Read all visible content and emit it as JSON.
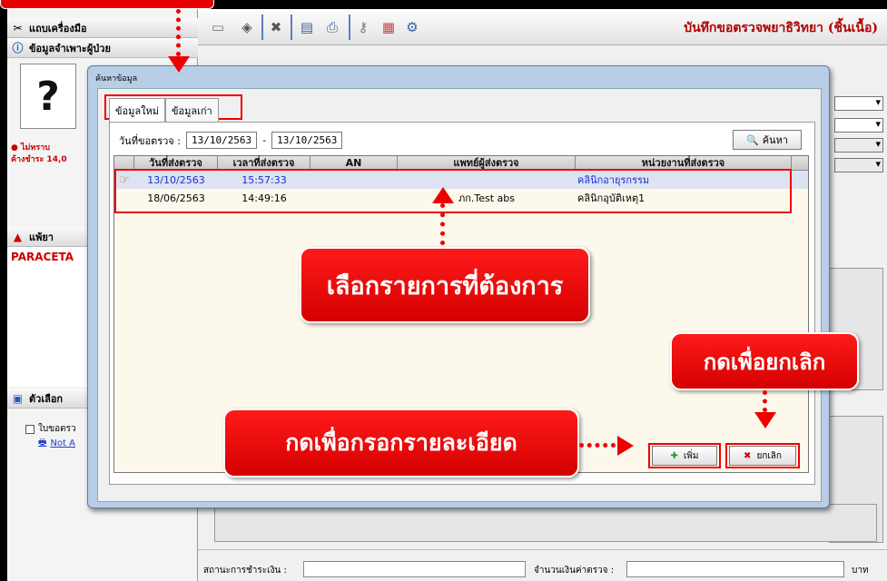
{
  "left_panel": {
    "toolbar_label": "แถบเครื่องมือ",
    "patient_info_label": "ข้อมูลจำเพาะผู้ป่วย",
    "photo_placeholder": "?",
    "unknown_label": "ไม่ทราบ",
    "balance_label": "ค้างชำระ 14,0",
    "drug_section_label": "แพ้ยา",
    "drug_name": "PARACETA",
    "options_label": "ตัวเลือก",
    "option_request": "ใบขอตรว",
    "option_printer": "Not A"
  },
  "header": {
    "title": "บันทึกขอตรวจพยาธิวิทยา (ชิ้นเนื้อ)"
  },
  "status_bar": {
    "payment_status_label": "สถานะการชำระเงิน :",
    "amount_label": "จำนวนเงินค่าตรวจ :",
    "currency_label": "บาท"
  },
  "dialog": {
    "title": "ค้นหาข้อมูล",
    "tabs": [
      {
        "label": "ข้อมูลใหม่"
      },
      {
        "label": "ข้อมูลเก่า"
      }
    ],
    "date_filter": {
      "label": "วันที่ขอตรวจ :",
      "from": "13/10/2563",
      "separator": "-",
      "to": "13/10/2563"
    },
    "search_button": "ค้นหา",
    "columns": [
      "วันที่ส่งตรวจ",
      "เวลาที่ส่งตรวจ",
      "AN",
      "แพทย์ผู้ส่งตรวจ",
      "หน่วยงานที่ส่งตรวจ"
    ],
    "rows": [
      {
        "date": "13/10/2563",
        "time": "15:57:33",
        "an": "",
        "doctor": "",
        "department": "คลินิกอายุรกรรม"
      },
      {
        "date": "18/06/2563",
        "time": "14:49:16",
        "an": "",
        "doctor": "ภก.Test abs",
        "department": "คลินิกอุบัติเหตุ1"
      }
    ],
    "add_button": "เพิ่ม",
    "cancel_button": "ยกเลิก"
  },
  "callouts": {
    "select_item": "เลือกรายการที่ต้องการ",
    "press_cancel": "กดเพื่อยกเลิก",
    "press_fill_detail": "กดเพื่อกรอกรายละเอียด"
  }
}
